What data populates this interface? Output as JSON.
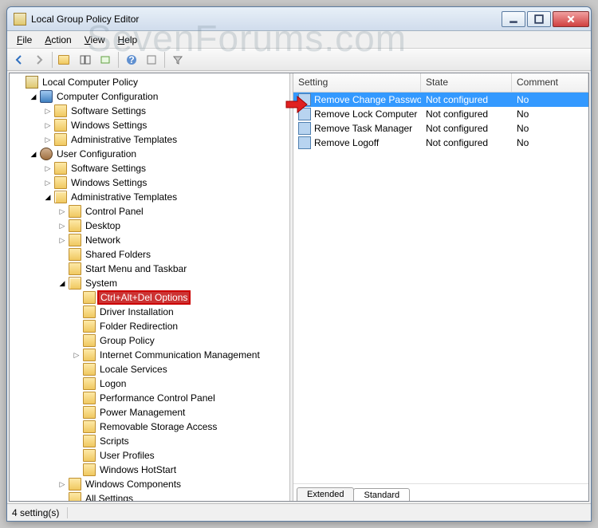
{
  "window": {
    "title": "Local Group Policy Editor"
  },
  "menu": {
    "file": "File",
    "action": "Action",
    "view": "View",
    "help": "Help"
  },
  "tree": {
    "root": "Local Computer Policy",
    "computer_config": "Computer Configuration",
    "cc_software": "Software Settings",
    "cc_windows": "Windows Settings",
    "cc_admin": "Administrative Templates",
    "user_config": "User Configuration",
    "uc_software": "Software Settings",
    "uc_windows": "Windows Settings",
    "uc_admin": "Administrative Templates",
    "at_control_panel": "Control Panel",
    "at_desktop": "Desktop",
    "at_network": "Network",
    "at_shared": "Shared Folders",
    "at_start": "Start Menu and Taskbar",
    "at_system": "System",
    "sys_ctrlaltdel": "Ctrl+Alt+Del Options",
    "sys_driver": "Driver Installation",
    "sys_folder": "Folder Redirection",
    "sys_gp": "Group Policy",
    "sys_icm": "Internet Communication Management",
    "sys_locale": "Locale Services",
    "sys_logon": "Logon",
    "sys_perf": "Performance Control Panel",
    "sys_power": "Power Management",
    "sys_removable": "Removable Storage Access",
    "sys_scripts": "Scripts",
    "sys_profiles": "User Profiles",
    "sys_hotstart": "Windows HotStart",
    "at_wincomp": "Windows Components",
    "at_all": "All Settings"
  },
  "list": {
    "headers": {
      "setting": "Setting",
      "state": "State",
      "comment": "Comment"
    },
    "rows": [
      {
        "setting": "Remove Change Password",
        "state": "Not configured",
        "comment": "No"
      },
      {
        "setting": "Remove Lock Computer",
        "state": "Not configured",
        "comment": "No"
      },
      {
        "setting": "Remove Task Manager",
        "state": "Not configured",
        "comment": "No"
      },
      {
        "setting": "Remove Logoff",
        "state": "Not configured",
        "comment": "No"
      }
    ]
  },
  "tabs": {
    "extended": "Extended",
    "standard": "Standard"
  },
  "status": {
    "count": "4 setting(s)"
  },
  "watermark": "SevenForums.com"
}
